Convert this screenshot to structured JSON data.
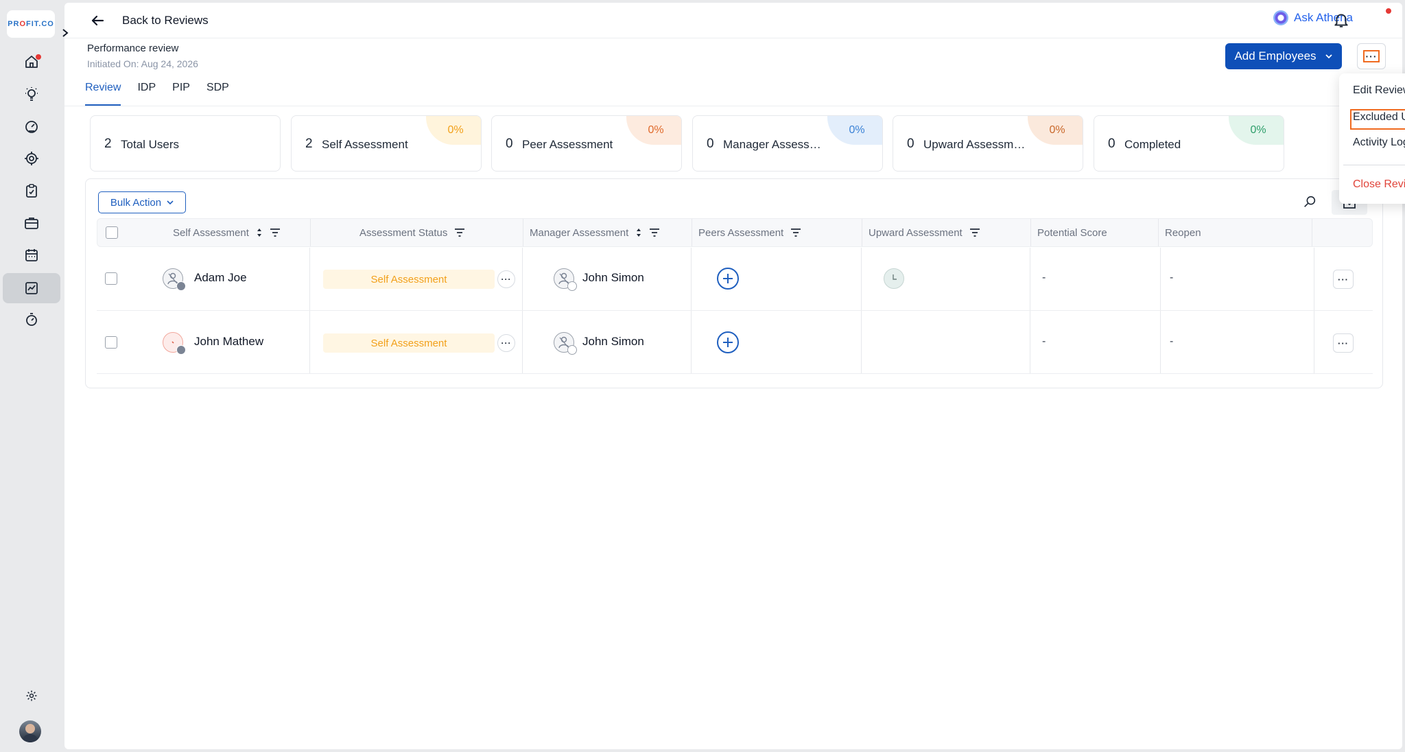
{
  "logo": {
    "text_pre": "PR",
    "text_o": "O",
    "text_post": "FIT.CO"
  },
  "sidebar": {
    "items": [
      {
        "icon": "home-icon"
      },
      {
        "icon": "lightbulb-icon"
      },
      {
        "icon": "gauge-icon"
      },
      {
        "icon": "target-icon"
      },
      {
        "icon": "clipboard-check-icon"
      },
      {
        "icon": "briefcase-icon"
      },
      {
        "icon": "calendar-icon"
      },
      {
        "icon": "performance-chart-icon",
        "active": true
      },
      {
        "icon": "stopwatch-icon"
      }
    ],
    "bottom": [
      {
        "icon": "gear-icon"
      },
      {
        "icon": "user-avatar"
      }
    ]
  },
  "header": {
    "back_label": "Back to Reviews",
    "ask_athena": "Ask Athena"
  },
  "review": {
    "title": "Performance review",
    "initiated": "Initiated On: Aug 24, 2026"
  },
  "tabs": [
    {
      "label": "Review",
      "active": true
    },
    {
      "label": "IDP"
    },
    {
      "label": "PIP"
    },
    {
      "label": "SDP"
    }
  ],
  "actions": {
    "add_employees": "Add Employees"
  },
  "stats": [
    {
      "value": "2",
      "label": "Total Users",
      "pct": ""
    },
    {
      "value": "2",
      "label": "Self Assessment",
      "pct": "0%",
      "color": "#f2a01a",
      "bg": "#fff4dc"
    },
    {
      "value": "0",
      "label": "Peer Assessment",
      "pct": "0%",
      "color": "#e06a2b",
      "bg": "#fdebdf"
    },
    {
      "value": "0",
      "label": "Manager Assessm...",
      "pct": "0%",
      "color": "#3b82d6",
      "bg": "#e3eefb"
    },
    {
      "value": "0",
      "label": "Upward Assessme...",
      "pct": "0%",
      "color": "#c9682a",
      "bg": "#fbe9dc"
    },
    {
      "value": "0",
      "label": "Completed",
      "pct": "0%",
      "color": "#2e9e6a",
      "bg": "#e3f5ec"
    }
  ],
  "table": {
    "bulk_action": "Bulk Action",
    "columns": {
      "self": "Self Assessment",
      "status": "Assessment Status",
      "manager": "Manager Assessment",
      "peers": "Peers Assessment",
      "upward": "Upward Assessment",
      "potential": "Potential Score",
      "reopen": "Reopen"
    },
    "rows": [
      {
        "name": "Adam Joe",
        "status": "Self Assessment",
        "manager": "John Simon",
        "potential": "-",
        "reopen": "-"
      },
      {
        "name": "John Mathew",
        "status": "Self Assessment",
        "manager": "John Simon",
        "potential": "-",
        "reopen": "-"
      }
    ]
  },
  "menu": {
    "items": [
      "Edit Review",
      "Excluded Users",
      "Activity Log"
    ],
    "danger": "Close Review"
  },
  "colors": {
    "accent": "#0e4fb8",
    "highlight": "#f06a1f",
    "danger": "#e0443a"
  }
}
